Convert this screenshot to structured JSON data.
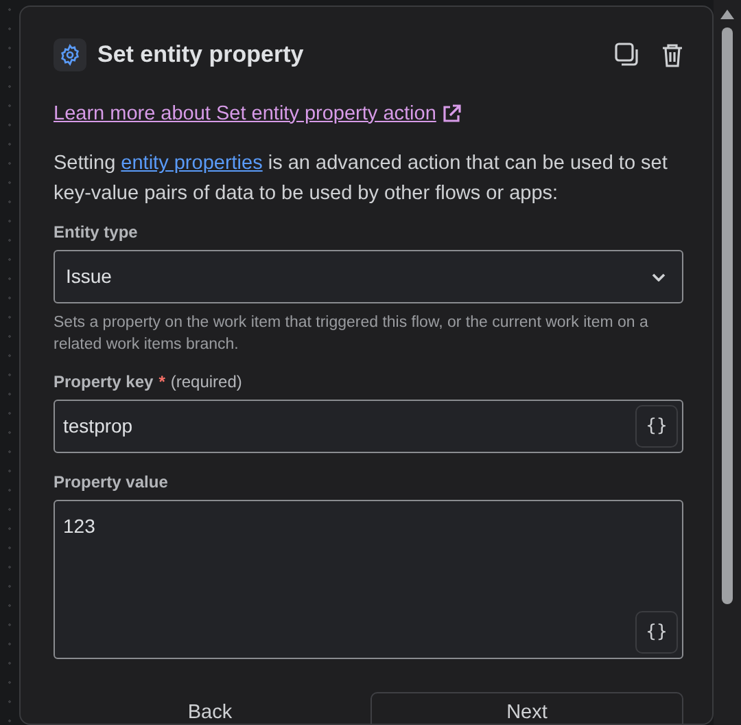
{
  "header": {
    "title": "Set entity property"
  },
  "learn_link": {
    "text": "Learn more about Set entity property action"
  },
  "intro": {
    "before": "Setting ",
    "link": "entity properties",
    "after": " is an advanced action that can be used to set key-value pairs of data to be used by other flows or apps:"
  },
  "entity_type": {
    "label": "Entity type",
    "value": "Issue",
    "help": "Sets a property on the work item that triggered this flow, or the current work item on a related work items branch."
  },
  "property_key": {
    "label": "Property key",
    "required_mark": "*",
    "required_text": "(required)",
    "value": "testprop",
    "smart_button": "{}"
  },
  "property_value": {
    "label": "Property value",
    "value": "123",
    "smart_button": "{}"
  },
  "buttons": [
    {
      "label": "Back",
      "kind": "subtle"
    },
    {
      "label": "Next",
      "kind": "outline"
    }
  ]
}
